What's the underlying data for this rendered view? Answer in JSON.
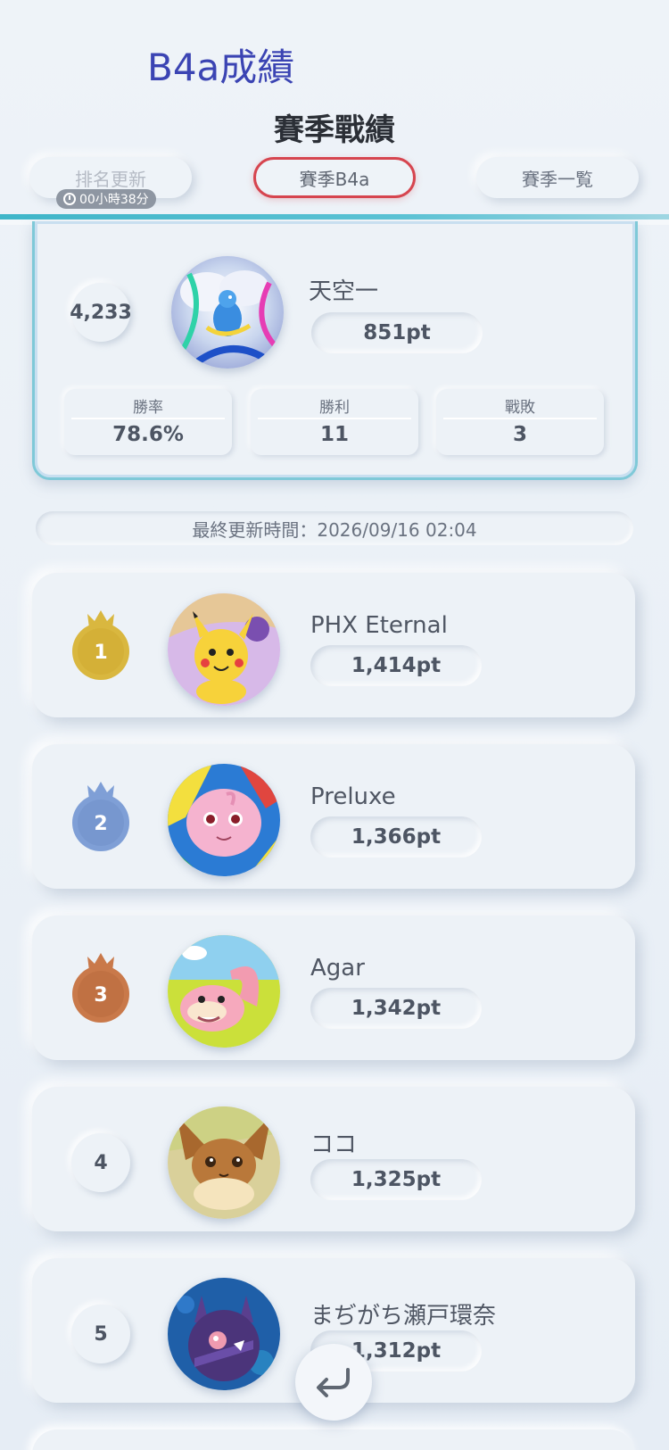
{
  "page_heading": "B4a成績",
  "season_title": "賽季戰績",
  "tabs": {
    "rank_update": "排名更新",
    "current_season": "賽季B4a",
    "season_list": "賽季一覧"
  },
  "timer": "00小時38分",
  "my_record": {
    "rank": "4,233",
    "name": "天空一",
    "points": "851pt",
    "stats": [
      {
        "label": "勝率",
        "value": "78.6%"
      },
      {
        "label": "勝利",
        "value": "11"
      },
      {
        "label": "戰敗",
        "value": "3"
      }
    ]
  },
  "last_updated": "最終更新時間：2026/09/16 02:04",
  "leaderboard": [
    {
      "rank": "1",
      "name": "PHX Eternal",
      "points": "1,414pt",
      "medal_color": "#d9b73f"
    },
    {
      "rank": "2",
      "name": "Preluxe",
      "points": "1,366pt",
      "medal_color": "#7f9fd6"
    },
    {
      "rank": "3",
      "name": "Agar",
      "points": "1,342pt",
      "medal_color": "#c9794a"
    },
    {
      "rank": "4",
      "name": "ココ",
      "points": "1,325pt"
    },
    {
      "rank": "5",
      "name": "まぢがち瀬戸環奈",
      "points": "1,312pt"
    }
  ],
  "icons": {
    "clock": "clock-icon",
    "back": "return-arrow-icon",
    "crown": "crown-icon"
  }
}
